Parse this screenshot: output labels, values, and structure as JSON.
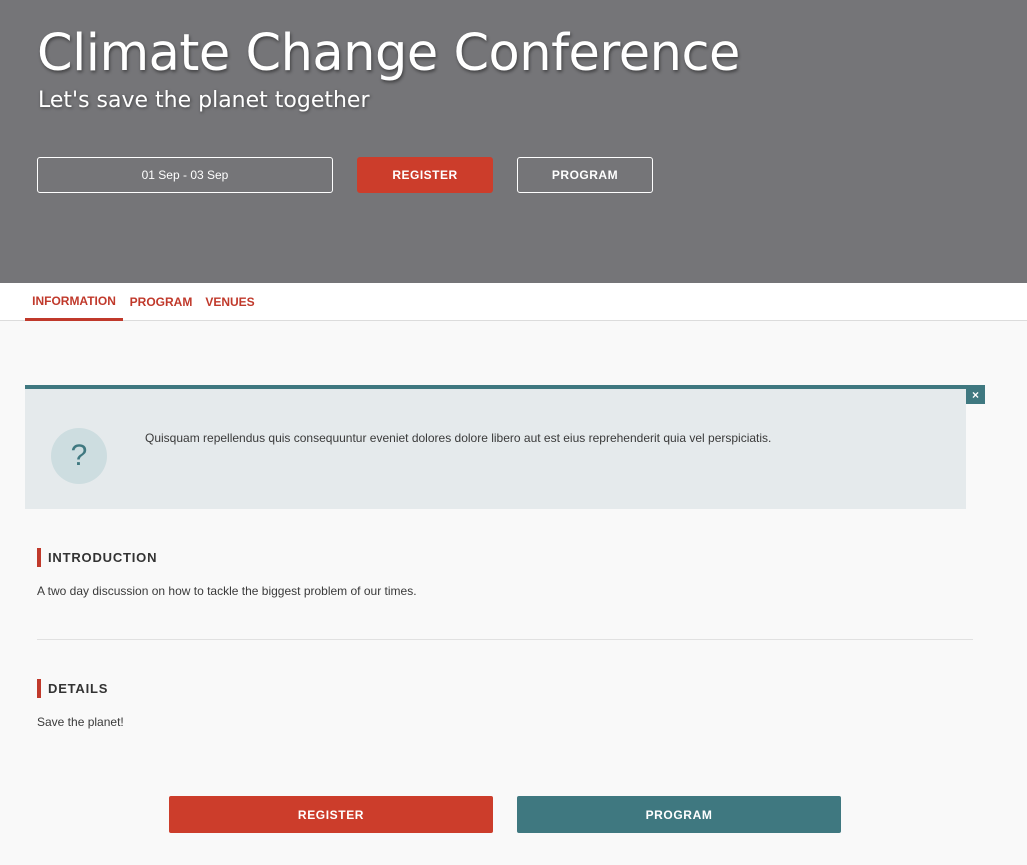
{
  "colors": {
    "accent_red": "#cc3d2b",
    "accent_teal": "#3f7880",
    "hero_background": "#757578",
    "notice_background": "#e5eaec"
  },
  "hero": {
    "title": "Climate Change Conference",
    "subtitle": "Let's save the planet together",
    "date_range": "01 Sep - 03 Sep",
    "register_label": "REGISTER",
    "program_label": "PROGRAM"
  },
  "tabs": [
    {
      "label": "INFORMATION",
      "active": true
    },
    {
      "label": "PROGRAM",
      "active": false
    },
    {
      "label": "VENUES",
      "active": false
    }
  ],
  "notice": {
    "icon": "question-icon",
    "icon_glyph": "?",
    "close_icon": "close-icon",
    "close_glyph": "×",
    "text": "Quisquam repellendus quis consequuntur eveniet dolores dolore libero aut est eius reprehenderit quia vel perspiciatis."
  },
  "sections": {
    "introduction": {
      "heading": "INTRODUCTION",
      "body": "A two day discussion on how to tackle the biggest problem of our times."
    },
    "details": {
      "heading": "DETAILS",
      "body": "Save the planet!"
    }
  },
  "footer_actions": {
    "register_label": "REGISTER",
    "program_label": "PROGRAM"
  }
}
